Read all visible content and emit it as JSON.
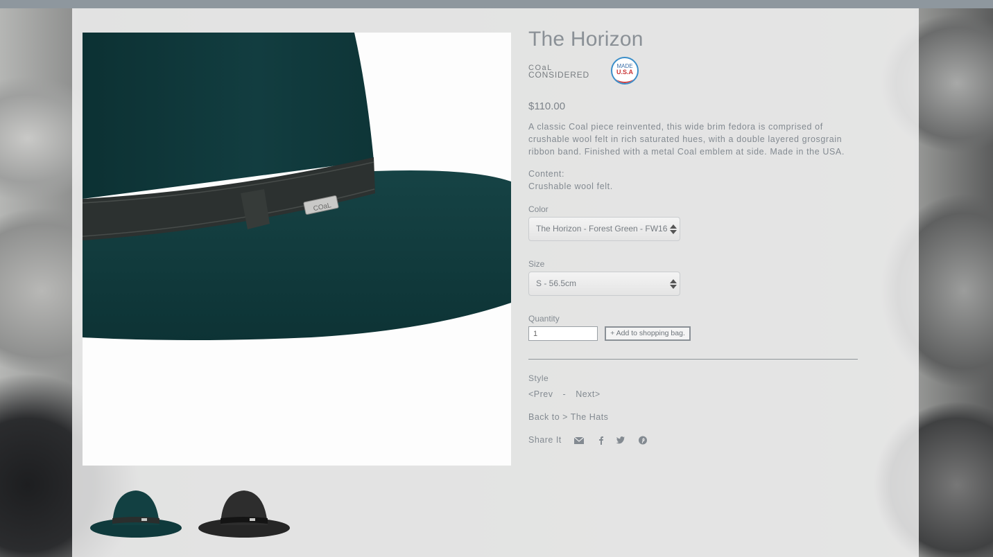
{
  "product": {
    "title": "The Horizon",
    "brand_logo_line1": "COaL",
    "brand_logo_line2": "CONSIDERED",
    "badge_line1": "MADE",
    "badge_line2": "U.S.A",
    "price": "$110.00",
    "description": "A classic Coal piece reinvented, this wide brim fedora is comprised of crushable wool felt in rich saturated hues, with a double layered grosgrain ribbon band. Finished with a metal Coal emblem at side. Made in the USA.",
    "content_label": "Content:",
    "content_value": "Crushable wool felt."
  },
  "form": {
    "color_label": "Color",
    "color_selected": "The Horizon - Forest Green - FW16",
    "size_label": "Size",
    "size_selected": "S - 56.5cm",
    "quantity_label": "Quantity",
    "quantity_value": "1",
    "add_button": "+ Add to shopping bag."
  },
  "nav": {
    "style_label": "Style",
    "prev": "<Prev",
    "separator": "-",
    "next": "Next>",
    "back_to": "Back to > The Hats",
    "share_label": "Share It"
  },
  "icons": {
    "share": [
      "mail-icon",
      "facebook-icon",
      "twitter-icon",
      "pinterest-icon"
    ]
  },
  "colors": {
    "hat_green": "#0f3a3c",
    "hat_black": "#262626",
    "text": "#838a91"
  }
}
